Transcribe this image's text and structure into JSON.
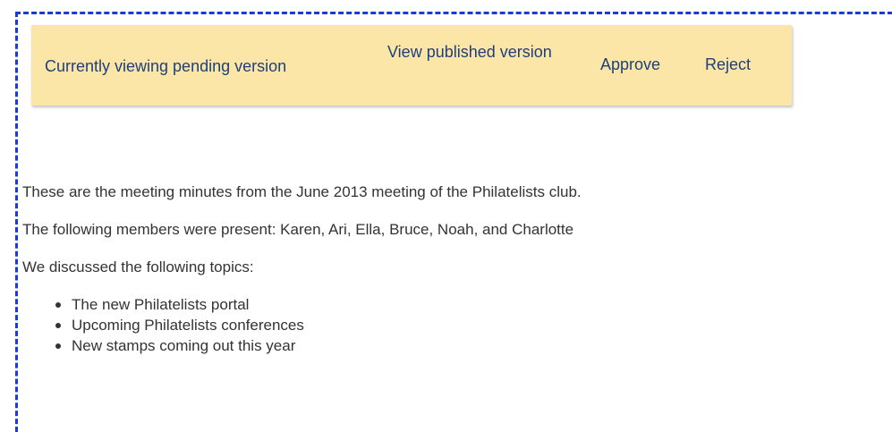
{
  "review_bar": {
    "status_text": "Currently viewing pending version",
    "view_published_label": "View published version",
    "approve_label": "Approve",
    "reject_label": "Reject"
  },
  "content": {
    "paragraphs": [
      "These are the meeting minutes from the June 2013 meeting of the Philatelists club.",
      "The following members were present: Karen, Ari, Ella, Bruce, Noah, and Charlotte",
      "We discussed the following topics:"
    ],
    "topics": [
      "The new Philatelists portal",
      "Upcoming Philatelists conferences",
      "New stamps coming out this year"
    ]
  },
  "colors": {
    "border_accent": "#1a3bd6",
    "bar_background": "#fbe6a8",
    "link_text": "#1f3f7a",
    "body_text": "#333333"
  }
}
